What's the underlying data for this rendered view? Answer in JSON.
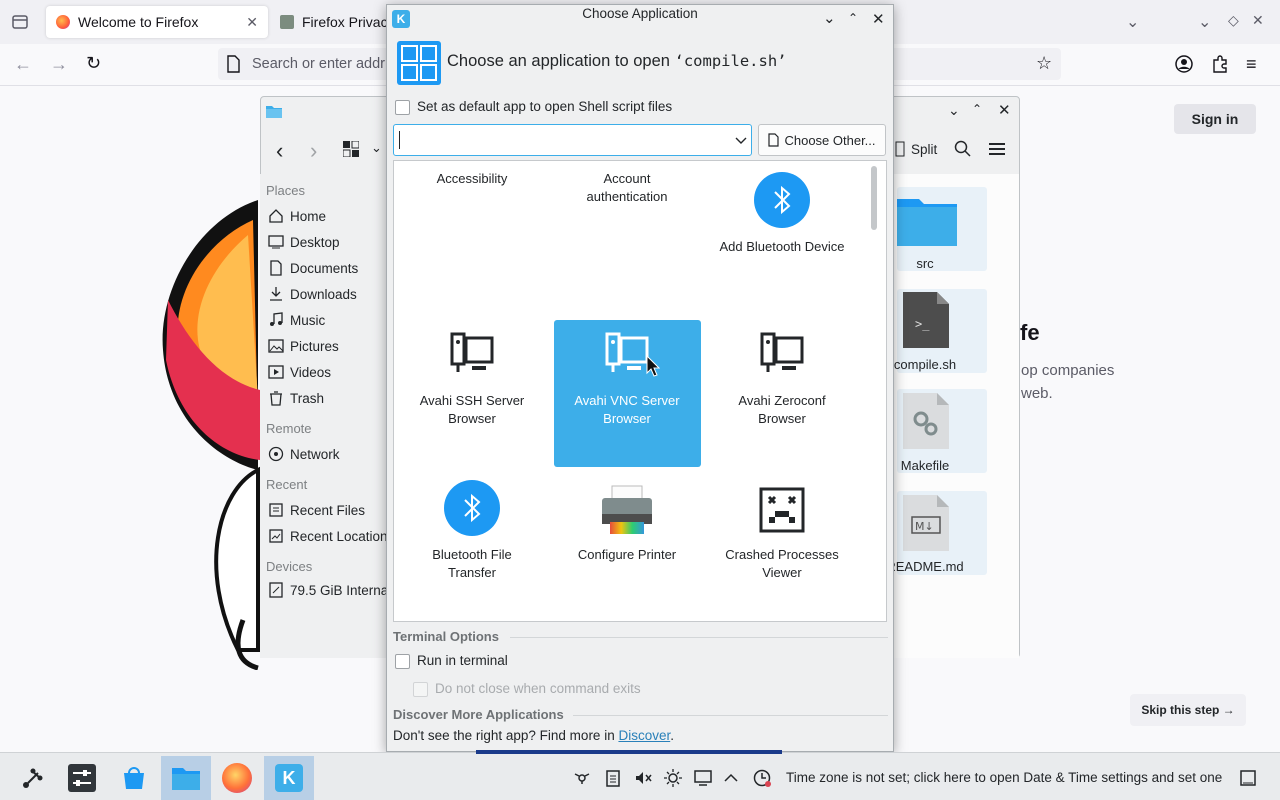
{
  "firefox": {
    "tab1_title": "Welcome to Firefox",
    "tab2_title": "Firefox Privac",
    "url_placeholder": "Search or enter addr",
    "heading_fragment": "fe",
    "body_line1": "op companies",
    "body_line2": "web.",
    "sign_in": "Sign in",
    "skip_step": "Skip this step →"
  },
  "dolphin": {
    "split_label": "Split",
    "places_header": "Places",
    "places": [
      "Home",
      "Desktop",
      "Documents",
      "Downloads",
      "Music",
      "Pictures",
      "Videos",
      "Trash"
    ],
    "remote_header": "Remote",
    "remote": [
      "Network"
    ],
    "recent_header": "Recent",
    "recent": [
      "Recent Files",
      "Recent Location"
    ],
    "devices_header": "Devices",
    "devices": [
      "79.5 GiB Interna"
    ],
    "files": [
      "src",
      "compile.sh",
      "Makefile",
      "README.md"
    ]
  },
  "dialog": {
    "window_title": "Choose Application",
    "heading_prefix": "Choose an application to open ",
    "heading_file": "‘compile.sh’",
    "default_app_label": "Set as default app to open Shell script files",
    "combo_value": "",
    "choose_other": "Choose Other...",
    "apps": [
      {
        "line1": "Accessibility",
        "line2": "",
        "icon": "accessibility-icon"
      },
      {
        "line1": "Account",
        "line2": "authentication",
        "icon": "account-icon"
      },
      {
        "line1": "Add Bluetooth Device",
        "line2": "",
        "icon": "bluetooth-icon"
      },
      {
        "line1": "Avahi SSH Server",
        "line2": "Browser",
        "icon": "network-computer-icon"
      },
      {
        "line1": "Avahi VNC Server",
        "line2": "Browser",
        "icon": "network-computer-icon",
        "selected": true
      },
      {
        "line1": "Avahi Zeroconf",
        "line2": "Browser",
        "icon": "network-computer-icon"
      },
      {
        "line1": "Bluetooth File",
        "line2": "Transfer",
        "icon": "bluetooth-icon"
      },
      {
        "line1": "Configure Printer",
        "line2": "",
        "icon": "printer-icon"
      },
      {
        "line1": "Crashed Processes",
        "line2": "Viewer",
        "icon": "crash-icon"
      }
    ],
    "terminal_header": "Terminal Options",
    "run_in_terminal": "Run in terminal",
    "no_close": "Do not close when command exits",
    "discover_header": "Discover More Applications",
    "discover_text": "Don't see the right app? Find more in ",
    "discover_link": "Discover",
    "discover_end": "."
  },
  "taskbar": {
    "status_text": "Time zone is not set; click here to open Date & Time settings and set one"
  },
  "colors": {
    "accent": "#3daee9",
    "selection": "#3daee9",
    "link": "#2980b9"
  }
}
